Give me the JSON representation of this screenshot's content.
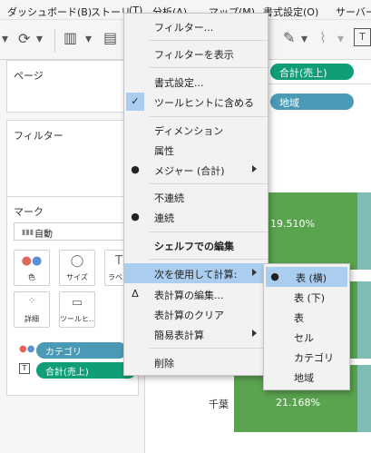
{
  "menubar": {
    "items": [
      "ダッシュボード(B)",
      "ストーリ",
      "(T)",
      "分析(A)",
      "マップ(M)",
      "書式設定(O)",
      "サーバー"
    ]
  },
  "sidebar": {
    "pages_title": "ページ",
    "filters_title": "フィルター",
    "marks_title": "マーク",
    "mark_type": "自動",
    "mark_buttons": [
      "色",
      "サイズ",
      "ラベル",
      "詳細",
      "ツールヒ…"
    ],
    "category_pill": "カテゴリ",
    "sum_sales_pill": "合計(売上)"
  },
  "shelves": {
    "rows_pill": "合計(売上)",
    "columns_pill": "地域"
  },
  "view": {
    "bar_labels": [
      "19.510%",
      "21.168%"
    ],
    "row_label": "千葉"
  },
  "context_menu": {
    "items": [
      {
        "label": "フィルター..."
      },
      {
        "label": "フィルターを表示"
      },
      {
        "label": "書式設定..."
      },
      {
        "label": "ツールヒントに含める",
        "mark": "✓"
      },
      {
        "label": "ディメンション"
      },
      {
        "label": "属性"
      },
      {
        "label": "メジャー (合計)",
        "mark": "●"
      },
      {
        "label": "不連続"
      },
      {
        "label": "連続",
        "mark": "●"
      },
      {
        "label": "シェルフでの編集"
      },
      {
        "label": "次を使用して計算:"
      },
      {
        "label": "表計算の編集...",
        "mark": "Δ"
      },
      {
        "label": "表計算のクリア"
      },
      {
        "label": "簡易表計算"
      },
      {
        "label": "削除"
      }
    ]
  },
  "submenu": {
    "items": [
      {
        "label": "表 (横)",
        "mark": "●"
      },
      {
        "label": "表 (下)"
      },
      {
        "label": "表"
      },
      {
        "label": "セル"
      },
      {
        "label": "カテゴリ"
      },
      {
        "label": "地域"
      }
    ]
  }
}
